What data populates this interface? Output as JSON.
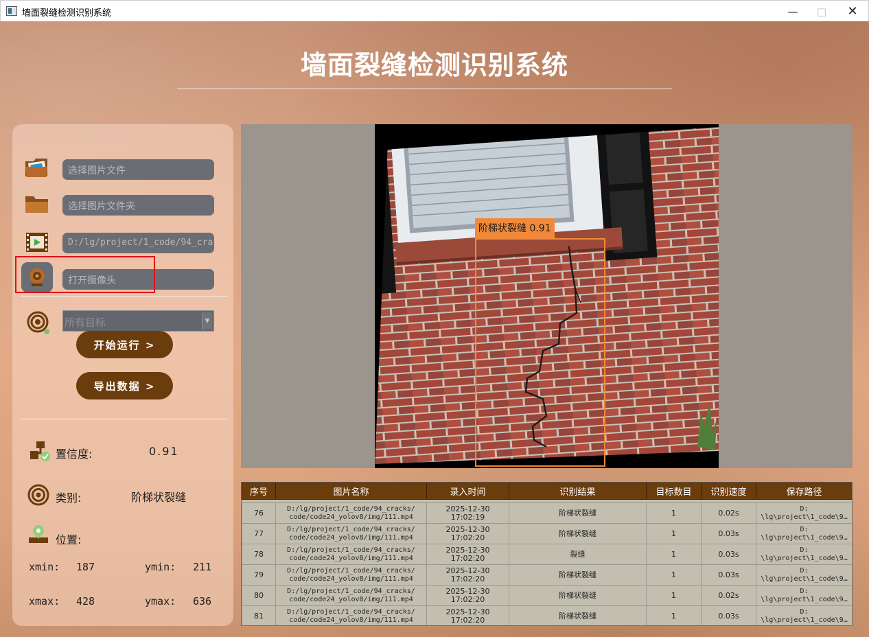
{
  "window": {
    "title": "墙面裂缝检测识别系统"
  },
  "app": {
    "heading": "墙面裂缝检测识别系统"
  },
  "inputs": {
    "image_file": {
      "placeholder": "选择图片文件"
    },
    "image_folder": {
      "placeholder": "选择图片文件夹"
    },
    "video_file": {
      "value": "D:/lg/project/1_code/94_cra"
    },
    "camera": {
      "placeholder": "打开摄像头"
    }
  },
  "target_select": {
    "selected": "所有目标"
  },
  "buttons": {
    "start": "开始运行 >",
    "export": "导出数据 >"
  },
  "stats": {
    "confidence_label": "置信度:",
    "confidence_value": "0.91",
    "class_label": "类别:",
    "class_value": "阶梯状裂缝",
    "position_label": "位置:",
    "xmin_label": "xmin:",
    "xmin": "187",
    "ymin_label": "ymin:",
    "ymin": "211",
    "xmax_label": "xmax:",
    "xmax": "428",
    "ymax_label": "ymax:",
    "ymax": "636"
  },
  "detection": {
    "label": "阶梯状裂缝 0.91"
  },
  "table": {
    "headers": [
      "序号",
      "图片名称",
      "录入时间",
      "识别结果",
      "目标数目",
      "识别速度",
      "保存路径"
    ],
    "rows": [
      {
        "id": "76",
        "name_1": "D:/lg/project/1_code/94_cracks/",
        "name_2": "code/code24_yolov8/img/111.mp4",
        "date": "2025-12-30",
        "time": "17:02:19",
        "result": "阶梯状裂缝",
        "count": "1",
        "speed": "0.02s",
        "path_1": "D:",
        "path_2": "\\lg\\project\\1_code\\9…"
      },
      {
        "id": "77",
        "name_1": "D:/lg/project/1_code/94_cracks/",
        "name_2": "code/code24_yolov8/img/111.mp4",
        "date": "2025-12-30",
        "time": "17:02:20",
        "result": "阶梯状裂缝",
        "count": "1",
        "speed": "0.03s",
        "path_1": "D:",
        "path_2": "\\lg\\project\\1_code\\9…"
      },
      {
        "id": "78",
        "name_1": "D:/lg/project/1_code/94_cracks/",
        "name_2": "code/code24_yolov8/img/111.mp4",
        "date": "2025-12-30",
        "time": "17:02:20",
        "result": "裂缝",
        "count": "1",
        "speed": "0.03s",
        "path_1": "D:",
        "path_2": "\\lg\\project\\1_code\\9…"
      },
      {
        "id": "79",
        "name_1": "D:/lg/project/1_code/94_cracks/",
        "name_2": "code/code24_yolov8/img/111.mp4",
        "date": "2025-12-30",
        "time": "17:02:20",
        "result": "阶梯状裂缝",
        "count": "1",
        "speed": "0.03s",
        "path_1": "D:",
        "path_2": "\\lg\\project\\1_code\\9…"
      },
      {
        "id": "80",
        "name_1": "D:/lg/project/1_code/94_cracks/",
        "name_2": "code/code24_yolov8/img/111.mp4",
        "date": "2025-12-30",
        "time": "17:02:20",
        "result": "阶梯状裂缝",
        "count": "1",
        "speed": "0.02s",
        "path_1": "D:",
        "path_2": "\\lg\\project\\1_code\\9…"
      },
      {
        "id": "81",
        "name_1": "D:/lg/project/1_code/94_cracks/",
        "name_2": "code/code24_yolov8/img/111.mp4",
        "date": "2025-12-30",
        "time": "17:02:20",
        "result": "阶梯状裂缝",
        "count": "1",
        "speed": "0.03s",
        "path_1": "D:",
        "path_2": "\\lg\\project\\1_code\\9…"
      }
    ]
  },
  "colors": {
    "accent_brown": "#6b3c0c",
    "detection_orange": "#f08a3a",
    "highlight_red": "#e0101a",
    "field_gray": "#6a6d73"
  },
  "icons": {
    "image_file": "image-file-icon",
    "image_folder": "folder-icon",
    "video_file": "video-icon",
    "camera": "camera-icon",
    "target": "target-icon",
    "confidence": "confidence-icon",
    "class": "class-icon",
    "position": "location-icon"
  }
}
